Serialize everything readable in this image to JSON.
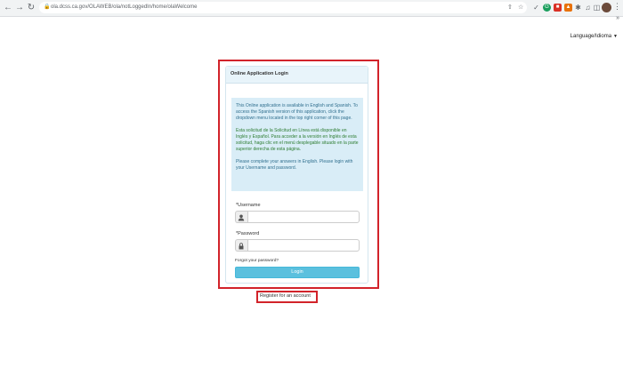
{
  "browser": {
    "url": "ola.dcss.ca.gov/OLAWEB/ola/notLoggedIn/home/olaWelcome",
    "nav_back": "←",
    "nav_forward": "→",
    "nav_reload": "↻"
  },
  "header": {
    "language_menu": "Language/Idioma"
  },
  "login_panel": {
    "title": "Online Application Login",
    "info_en": "This Online application is available in English and Spanish. To access the Spanish version of this application, click the dropdown menu located in the top right corner of this page.",
    "info_es": "Esta solicitud de la Solicitud en Línea está disponible en Inglés y Español. Para acceder a la versión en Inglés de esta solicitud, haga clic en el menú desplegable situado en la parte superior derecha de esta página.",
    "info_note": "Please complete your answers in English. Please login with your Username and password.",
    "username_label": "*Username",
    "username_value": "",
    "password_label": "*Password",
    "password_value": "",
    "forgot_link": "Forgot your password?",
    "login_button": "Login"
  },
  "footer": {
    "register_link": "Register for an account"
  },
  "colors": {
    "highlight": "#d2232a",
    "info_bg": "#d9edf7",
    "button": "#5bc0de"
  }
}
